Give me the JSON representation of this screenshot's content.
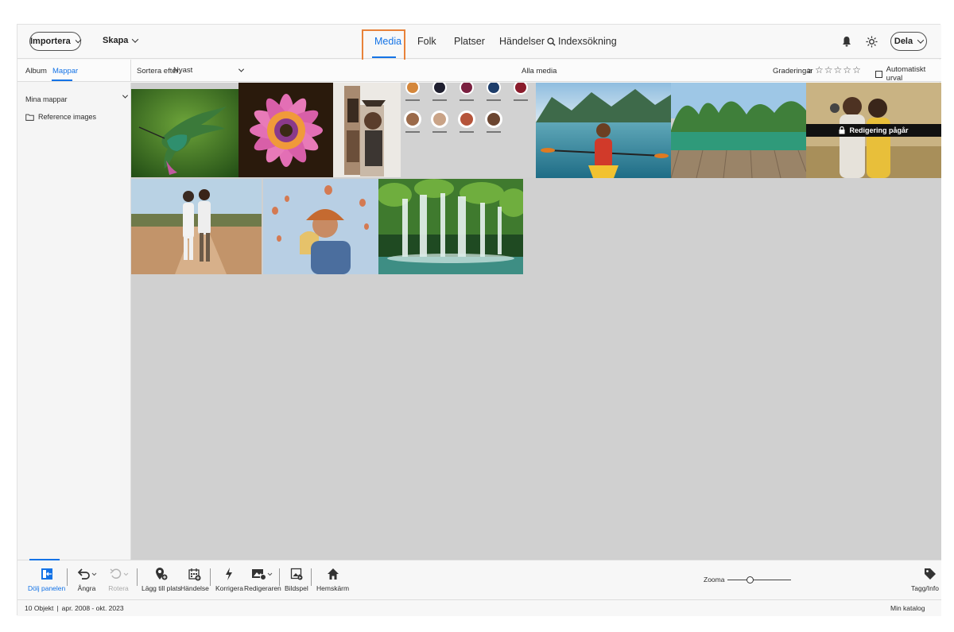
{
  "header": {
    "import_label": "Importera",
    "create_label": "Skapa",
    "tabs": [
      {
        "label": "Media",
        "active": true
      },
      {
        "label": "Folk"
      },
      {
        "label": "Platser"
      },
      {
        "label": "Händelser"
      },
      {
        "label": "Indexsökning",
        "icon": "search-icon"
      }
    ],
    "share_label": "Dela",
    "accent_color": "#1473e6",
    "highlight_color": "#e8823a"
  },
  "subbar": {
    "album_tab": "Album",
    "folders_tab": "Mappar",
    "sort_label": "Sortera efter:",
    "sort_value": "Nyast",
    "all_media": "Alla media",
    "ratings_label": "Graderingar",
    "ratings_operator": "≥",
    "rating_stars": 5,
    "auto_select_label": "Automatiskt urval"
  },
  "sidebar": {
    "my_folders": "Mina mappar",
    "folder_name": "Reference images"
  },
  "grid": {
    "locked_overlay": "Redigering pågår",
    "photos": [
      {
        "subject": "Hummingbird"
      },
      {
        "subject": "Pink daisy flower"
      },
      {
        "subject": "Couple collage"
      },
      {
        "subject": "People face grid"
      },
      {
        "subject": "Woman in kayak on lake"
      },
      {
        "subject": "Green river landscape with wooden dock"
      },
      {
        "subject": "Couple taking selfie"
      },
      {
        "subject": "Couple walking on dirt road"
      },
      {
        "subject": "Couple selfie with hot-air balloons"
      },
      {
        "subject": "Waterfall in green forest"
      }
    ]
  },
  "toolbar": {
    "hide_panel": "Dölj panelen",
    "undo": "Ångra",
    "rotate": "Rotera",
    "add_place": "Lägg till plats",
    "event": "Händelse",
    "fix": "Korrigera",
    "editor": "Redigeraren",
    "slideshow": "Bildspel",
    "home": "Hemskärm",
    "zoom_label": "Zooma",
    "zoom_level": 0.35,
    "tags_info": "Tagg/Info"
  },
  "status": {
    "count": "10 Objekt",
    "range": "apr. 2008  - okt. 2023",
    "catalog": "Min katalog"
  }
}
